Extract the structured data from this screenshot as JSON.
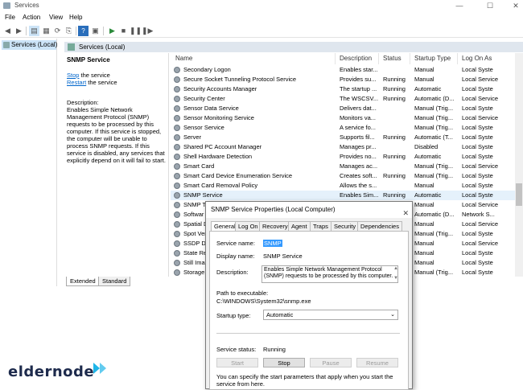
{
  "window": {
    "title": "Services"
  },
  "menu": [
    "File",
    "Action",
    "View",
    "Help"
  ],
  "tree": {
    "node": "Services (Local)"
  },
  "pane_header": "Services (Local)",
  "desc": {
    "title": "SNMP Service",
    "stop_link": "Stop",
    "stop_rest": " the service",
    "restart_link": "Restart",
    "restart_rest": " the service",
    "description_label": "Description:",
    "description_text": "Enables Simple Network Management Protocol (SNMP) requests to be processed by this computer. If this service is stopped, the computer will be unable to process SNMP requests. If this service is disabled, any services that explicitly depend on it will fail to start."
  },
  "columns": [
    "Name",
    "Description",
    "Status",
    "Startup Type",
    "Log On As"
  ],
  "rows": [
    {
      "name": "Secondary Logon",
      "desc": "Enables star...",
      "status": "",
      "startup": "Manual",
      "logon": "Local Syste"
    },
    {
      "name": "Secure Socket Tunneling Protocol Service",
      "desc": "Provides su...",
      "status": "Running",
      "startup": "Manual",
      "logon": "Local Service"
    },
    {
      "name": "Security Accounts Manager",
      "desc": "The startup ...",
      "status": "Running",
      "startup": "Automatic",
      "logon": "Local Syste"
    },
    {
      "name": "Security Center",
      "desc": "The WSCSV...",
      "status": "Running",
      "startup": "Automatic (D...",
      "logon": "Local Service"
    },
    {
      "name": "Sensor Data Service",
      "desc": "Delivers dat...",
      "status": "",
      "startup": "Manual (Trig...",
      "logon": "Local Syste"
    },
    {
      "name": "Sensor Monitoring Service",
      "desc": "Monitors va...",
      "status": "",
      "startup": "Manual (Trig...",
      "logon": "Local Service"
    },
    {
      "name": "Sensor Service",
      "desc": "A service fo...",
      "status": "",
      "startup": "Manual (Trig...",
      "logon": "Local Syste"
    },
    {
      "name": "Server",
      "desc": "Supports fil...",
      "status": "Running",
      "startup": "Automatic (T...",
      "logon": "Local Syste"
    },
    {
      "name": "Shared PC Account Manager",
      "desc": "Manages pr...",
      "status": "",
      "startup": "Disabled",
      "logon": "Local Syste"
    },
    {
      "name": "Shell Hardware Detection",
      "desc": "Provides no...",
      "status": "Running",
      "startup": "Automatic",
      "logon": "Local Syste"
    },
    {
      "name": "Smart Card",
      "desc": "Manages ac...",
      "status": "",
      "startup": "Manual (Trig...",
      "logon": "Local Service"
    },
    {
      "name": "Smart Card Device Enumeration Service",
      "desc": "Creates soft...",
      "status": "Running",
      "startup": "Manual (Trig...",
      "logon": "Local Syste"
    },
    {
      "name": "Smart Card Removal Policy",
      "desc": "Allows the s...",
      "status": "",
      "startup": "Manual",
      "logon": "Local Syste"
    },
    {
      "name": "SNMP Service",
      "desc": "Enables Sim...",
      "status": "Running",
      "startup": "Automatic",
      "logon": "Local Syste"
    },
    {
      "name": "SNMP T",
      "desc": "",
      "status": "",
      "startup": "Manual",
      "logon": "Local Service"
    },
    {
      "name": "Softwar",
      "desc": "",
      "status": "",
      "startup": "Automatic (D...",
      "logon": "Network S..."
    },
    {
      "name": "Spatial D",
      "desc": "",
      "status": "",
      "startup": "Manual",
      "logon": "Local Service"
    },
    {
      "name": "Spot Ver",
      "desc": "",
      "status": "",
      "startup": "Manual (Trig...",
      "logon": "Local Syste"
    },
    {
      "name": "SSDP Di",
      "desc": "",
      "status": "",
      "startup": "Manual",
      "logon": "Local Service"
    },
    {
      "name": "State Re",
      "desc": "",
      "status": "",
      "startup": "Manual",
      "logon": "Local Syste"
    },
    {
      "name": "Still Ima",
      "desc": "",
      "status": "",
      "startup": "Manual",
      "logon": "Local Syste"
    },
    {
      "name": "Storage",
      "desc": "",
      "status": "",
      "startup": "Manual (Trig...",
      "logon": "Local Syste"
    }
  ],
  "bottom_tabs": [
    "Extended",
    "Standard"
  ],
  "dialog": {
    "title": "SNMP Service Properties (Local Computer)",
    "close": "✕",
    "tabs": [
      "General",
      "Log On",
      "Recovery",
      "Agent",
      "Traps",
      "Security",
      "Dependencies"
    ],
    "service_name_label": "Service name:",
    "service_name_value": "SNMP",
    "display_name_label": "Display name:",
    "display_name_value": "SNMP Service",
    "description_label": "Description:",
    "description_value": "Enables Simple Network Management Protocol (SNMP) requests to be processed by this computer.",
    "path_label": "Path to executable:",
    "path_value": "C:\\WINDOWS\\System32\\snmp.exe",
    "startup_label": "Startup type:",
    "startup_value": "Automatic",
    "status_label": "Service status:",
    "status_value": "Running",
    "buttons": [
      "Start",
      "Stop",
      "Pause",
      "Resume"
    ],
    "footer": "You can specify the start parameters that apply when you start the service from here."
  },
  "logo": {
    "text": "eldernode",
    "accent": "#1fb5e8"
  }
}
